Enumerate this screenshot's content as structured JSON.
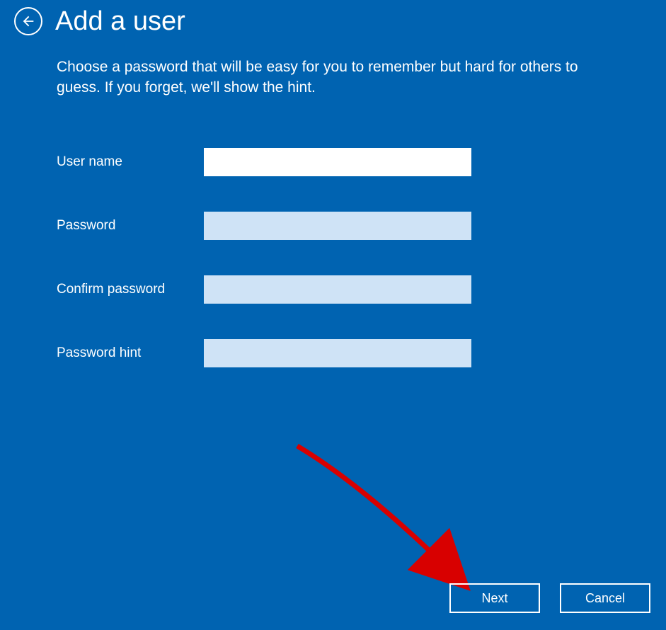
{
  "header": {
    "title": "Add a user",
    "back_icon": "back-arrow"
  },
  "description": "Choose a password that will be easy for you to remember but hard for others to guess. If you forget, we'll show the hint.",
  "form": {
    "username": {
      "label": "User name",
      "value": ""
    },
    "password": {
      "label": "Password",
      "value": ""
    },
    "confirm_password": {
      "label": "Confirm password",
      "value": ""
    },
    "password_hint": {
      "label": "Password hint",
      "value": ""
    }
  },
  "buttons": {
    "next": "Next",
    "cancel": "Cancel"
  },
  "colors": {
    "background": "#0063b1",
    "input_inactive": "#cfe3f6",
    "input_active": "#ffffff",
    "text": "#ffffff"
  },
  "annotation": {
    "arrow_color": "#d80000",
    "target": "next-button"
  }
}
